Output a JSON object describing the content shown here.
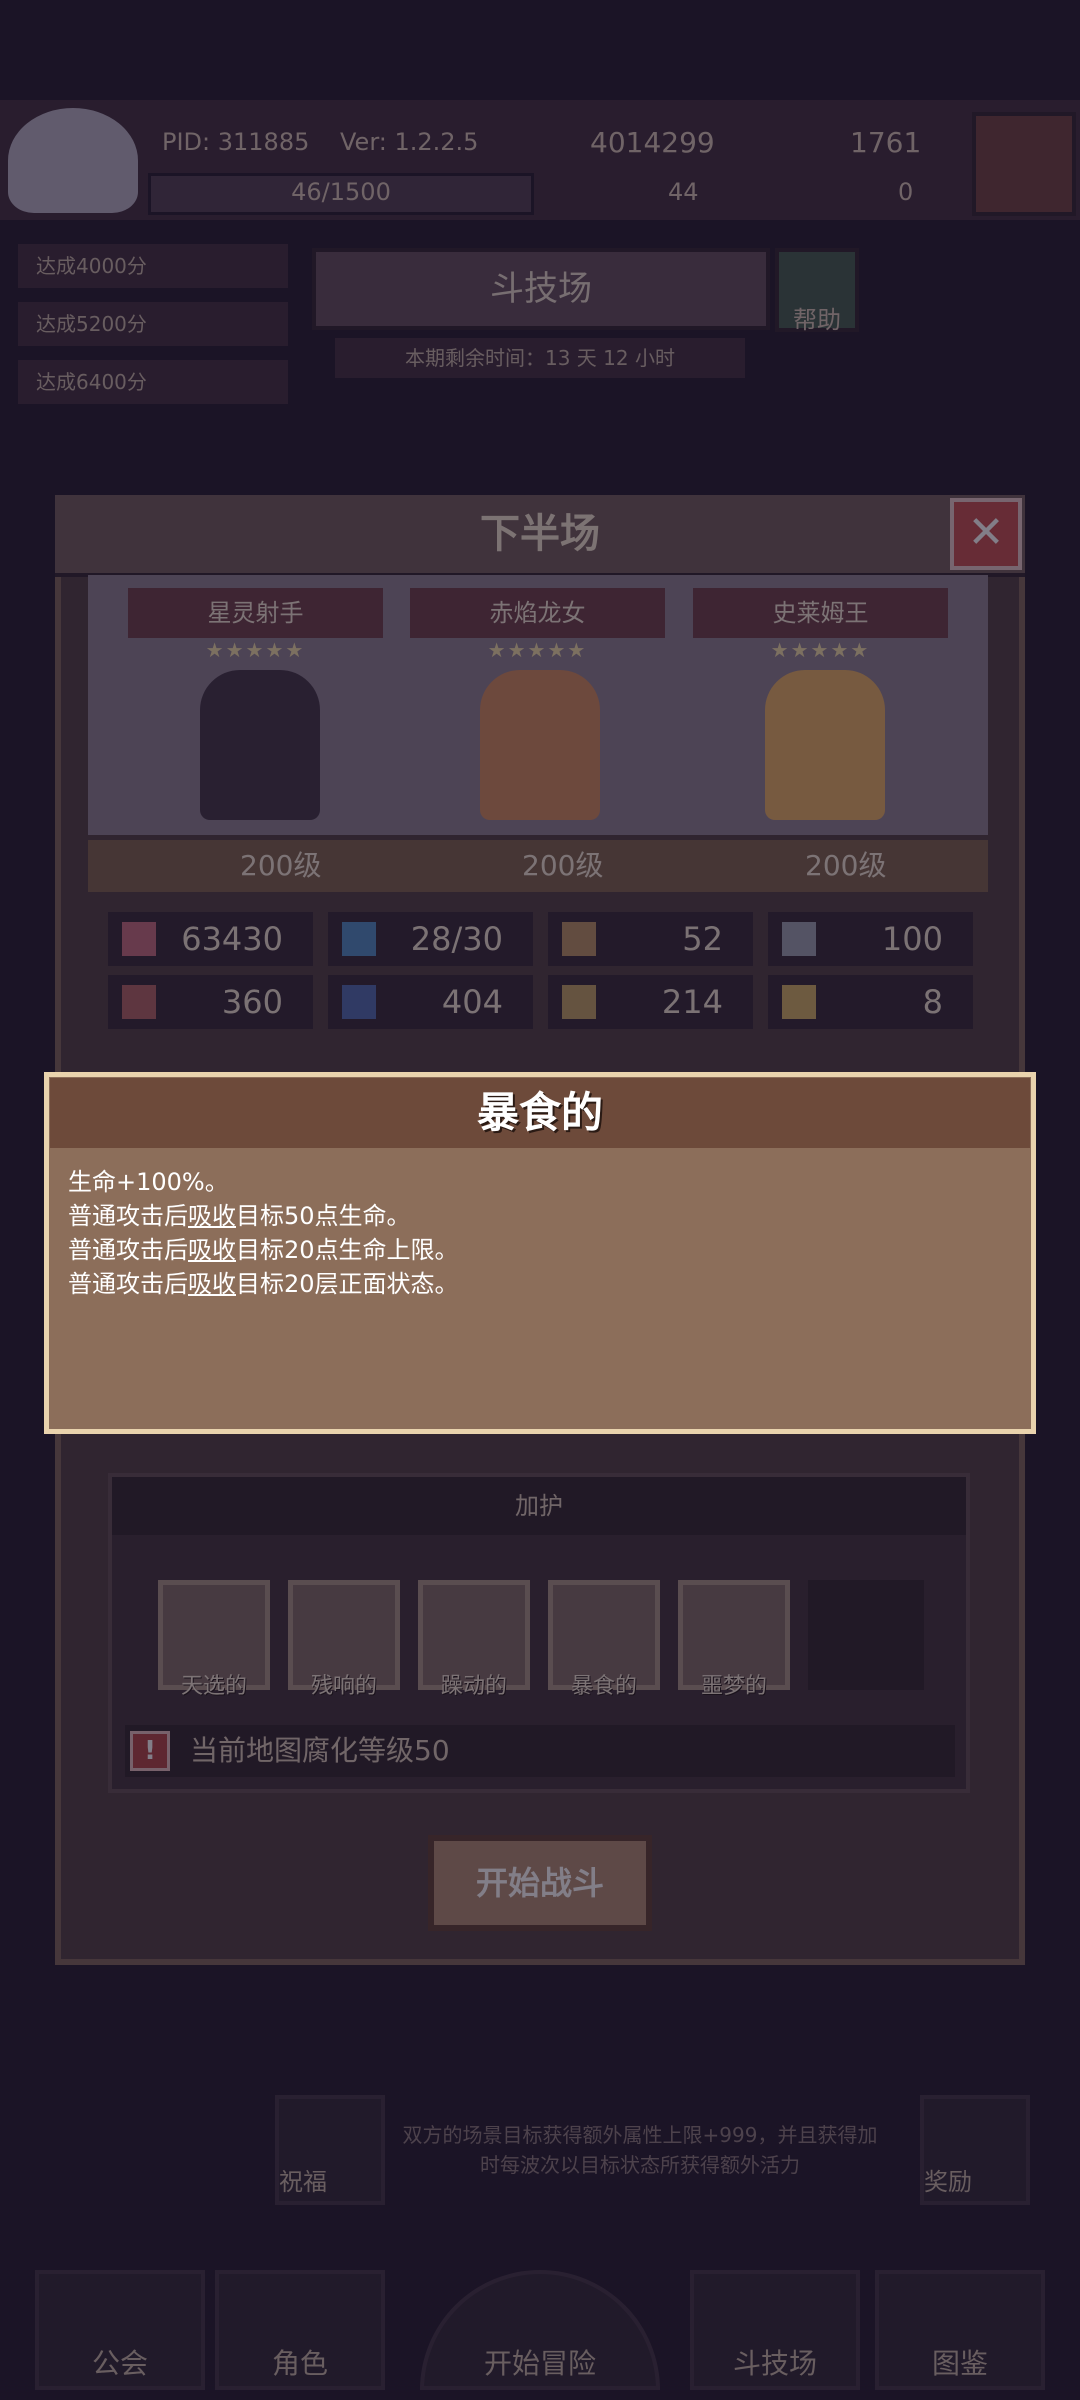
{
  "topbar": {
    "pid": "PID: 311885",
    "version": "Ver: 1.2.2.5",
    "gold": "4014299",
    "gems": "1761",
    "xp": "46/1500",
    "res2": "44",
    "res3": "0"
  },
  "quests": [
    "达成4000分",
    "达成5200分",
    "达成6400分"
  ],
  "arena": {
    "title": "斗技场",
    "help": "帮助",
    "timer": "本期剩余时间：13 天 12 小时"
  },
  "panel": {
    "title": "下半场",
    "heroes": [
      {
        "name": "星灵射手",
        "stars": "★★★★★",
        "level": "200级"
      },
      {
        "name": "赤焰龙女",
        "stars": "★★★★★",
        "level": "200级"
      },
      {
        "name": "史莱姆王",
        "stars": "★★★★★",
        "level": "200级"
      }
    ],
    "stats": [
      {
        "icon": "heart-icon",
        "value": "63430"
      },
      {
        "icon": "mana-drop-icon",
        "value": "28/30"
      },
      {
        "icon": "shield-icon",
        "value": "52"
      },
      {
        "icon": "wing-icon",
        "value": "100"
      },
      {
        "icon": "scroll-icon",
        "value": "360"
      },
      {
        "icon": "book-icon",
        "value": "404"
      },
      {
        "icon": "boot-icon",
        "value": "214"
      },
      {
        "icon": "magnet-icon",
        "value": "8"
      }
    ]
  },
  "popup": {
    "title": "暴食的",
    "lines": [
      {
        "pre": "生命+100%。",
        "u": "",
        "post": ""
      },
      {
        "pre": "普通攻击后",
        "u": "吸收",
        "post": "目标50点生命。"
      },
      {
        "pre": "普通攻击后",
        "u": "吸收",
        "post": "目标20点生命上限。"
      },
      {
        "pre": "普通攻击后",
        "u": "吸收",
        "post": "目标20层正面状态。"
      }
    ]
  },
  "guard": {
    "title": "加护",
    "affixes": [
      "天选的",
      "残响的",
      "躁动的",
      "暴食的",
      "噩梦的"
    ],
    "warning": "当前地图腐化等级50"
  },
  "start_button": "开始战斗",
  "side": {
    "bless": "祝福",
    "reward": "奖励",
    "scroll_text": "双方的场景目标获得额外属性上限+999，并且获得加时每波次以目标状态所获得额外活力"
  },
  "bottom_nav": [
    "公会",
    "角色",
    "开始冒险",
    "斗技场",
    "图鉴"
  ]
}
